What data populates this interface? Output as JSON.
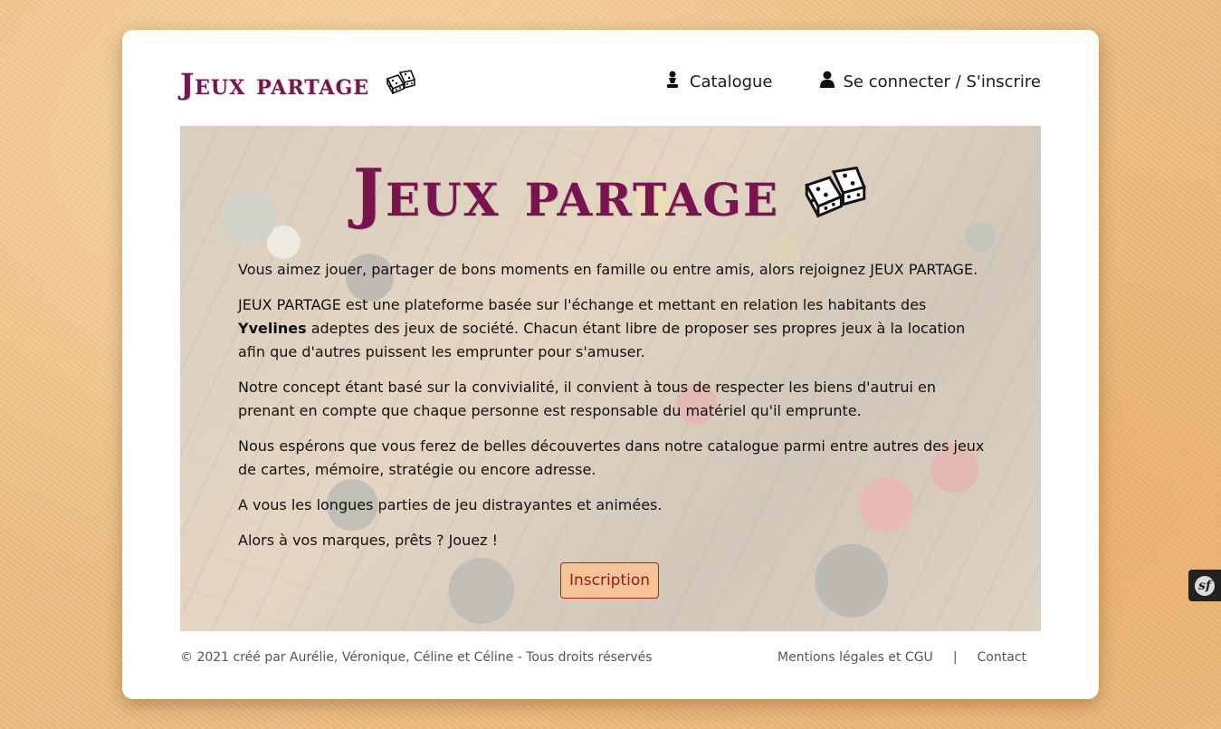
{
  "header": {
    "logo_text": "Jeux partage",
    "nav": [
      {
        "label": "Catalogue",
        "icon": "chess-pawn-icon"
      },
      {
        "label": "Se connecter / S'inscrire",
        "icon": "user-icon"
      }
    ]
  },
  "hero": {
    "logo_text": "Jeux partage",
    "paragraphs": {
      "p1": "Vous aimez jouer, partager de bons moments en famille ou entre amis, alors rejoignez JEUX PARTAGE.",
      "p2_before": "JEUX PARTAGE est une plateforme basée sur l'échange et mettant en relation les habitants des ",
      "p2_bold": "Yvelines",
      "p2_after": " adeptes des jeux de société. Chacun étant libre de proposer ses propres jeux à la location afin que d'autres puissent les emprunter pour s'amuser.",
      "p3": "Notre concept étant basé sur la convivialité, il convient à tous de respecter les biens d'autrui en prenant en compte que chaque personne est responsable du matériel qu'il emprunte.",
      "p4": "Nous espérons que vous ferez de belles découvertes dans notre catalogue parmi entre autres des jeux de cartes, mémoire, stratégie ou encore adresse.",
      "p5": "A vous les longues parties de jeu distrayantes et animées.",
      "p6": "Alors à vos marques, prêts ? Jouez !"
    },
    "cta_label": "Inscription"
  },
  "footer": {
    "copyright": "© 2021 créé par Aurélie, Véronique, Céline et Céline - Tous droits réservés",
    "links": {
      "legal": "Mentions légales et CGU",
      "separator": "|",
      "contact": "Contact"
    }
  },
  "debug_toolbar": {
    "icon": "symfony-icon",
    "label": "sf"
  },
  "colors": {
    "brand": "#7a1450",
    "background": "#edbd82",
    "cta_bg": "#f7c49a",
    "cta_border": "#9b2a16",
    "cta_text": "#8a1d1d"
  }
}
